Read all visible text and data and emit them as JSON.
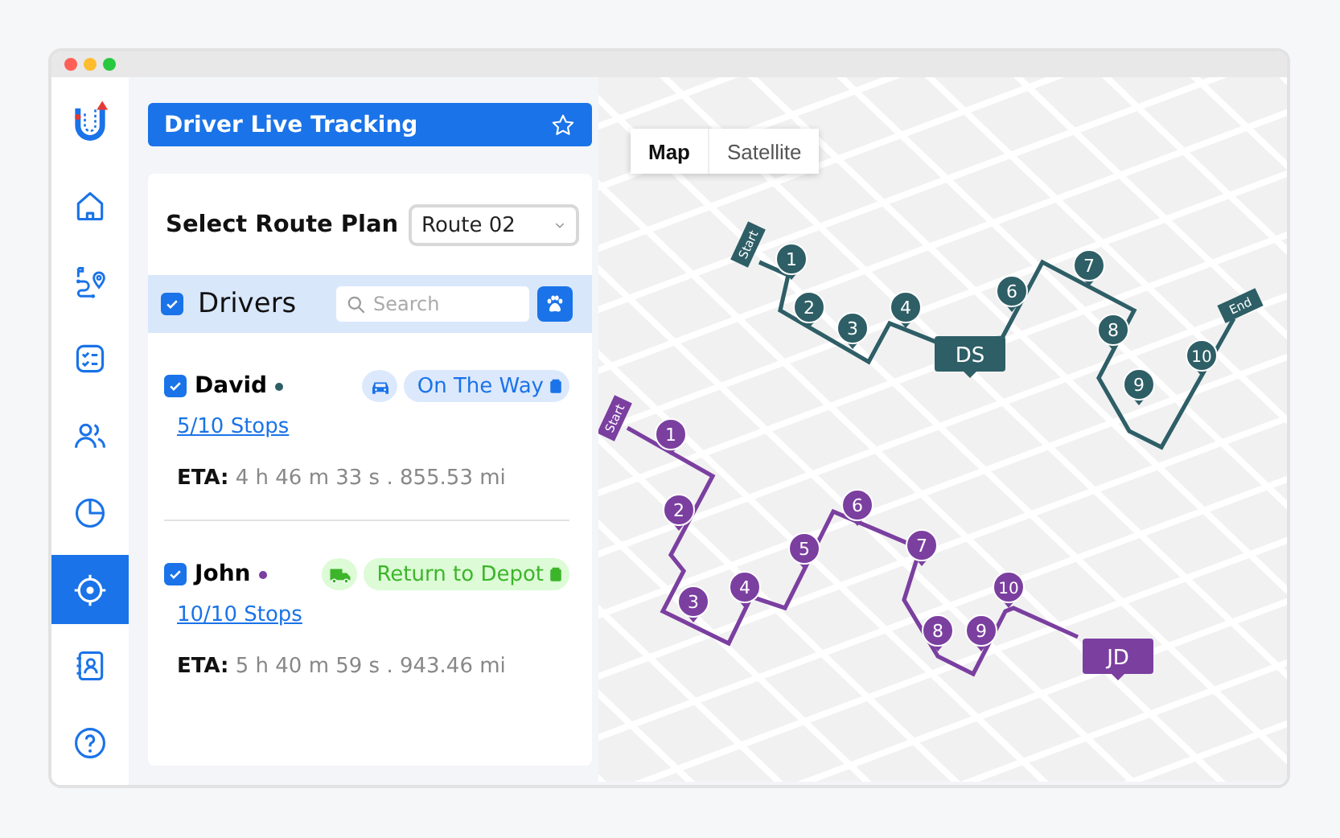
{
  "sidebar": {
    "items": [
      {
        "kind": "home",
        "selected": false
      },
      {
        "kind": "route",
        "selected": false
      },
      {
        "kind": "checklist",
        "selected": false
      },
      {
        "kind": "people",
        "selected": false
      },
      {
        "kind": "chart",
        "selected": false
      },
      {
        "kind": "target",
        "selected": true
      },
      {
        "kind": "contacts",
        "selected": false
      },
      {
        "kind": "help",
        "selected": false
      }
    ]
  },
  "header": {
    "title": "Driver Live Tracking",
    "starred": false
  },
  "route_plan": {
    "label": "Select Route Plan",
    "value": "Route 02"
  },
  "drivers": {
    "title": "Drivers",
    "checked": true,
    "search": {
      "placeholder": "Search"
    },
    "items": [
      {
        "name": "David",
        "color": "#2e5e66",
        "checked": true,
        "kind": "on_the_way",
        "status": "On The Way",
        "stops": "5/10 Stops",
        "eta_label": "ETA:",
        "eta": "4 h 46 m 33 s . 855.53 mi"
      },
      {
        "name": "John",
        "color": "#7b3fa0",
        "checked": true,
        "kind": "return_to_depot",
        "status": "Return to Depot",
        "stops": "10/10 Stops",
        "eta_label": "ETA:",
        "eta": "5 h 40 m 59 s . 943.46 mi"
      }
    ]
  },
  "map": {
    "modes": [
      {
        "label": "Map",
        "selected": true
      },
      {
        "label": "Satellite",
        "selected": false
      }
    ],
    "routes": [
      {
        "color": "#2e5e66",
        "start": "Start",
        "end": "End",
        "driver_tag": "DS",
        "stops": [
          "1",
          "2",
          "3",
          "4",
          "6",
          "7",
          "8",
          "9",
          "10"
        ]
      },
      {
        "color": "#7b3fa0",
        "start": "Start",
        "driver_tag": "JD",
        "stops": [
          "1",
          "2",
          "3",
          "4",
          "5",
          "6",
          "7",
          "8",
          "9",
          "10"
        ]
      }
    ]
  }
}
